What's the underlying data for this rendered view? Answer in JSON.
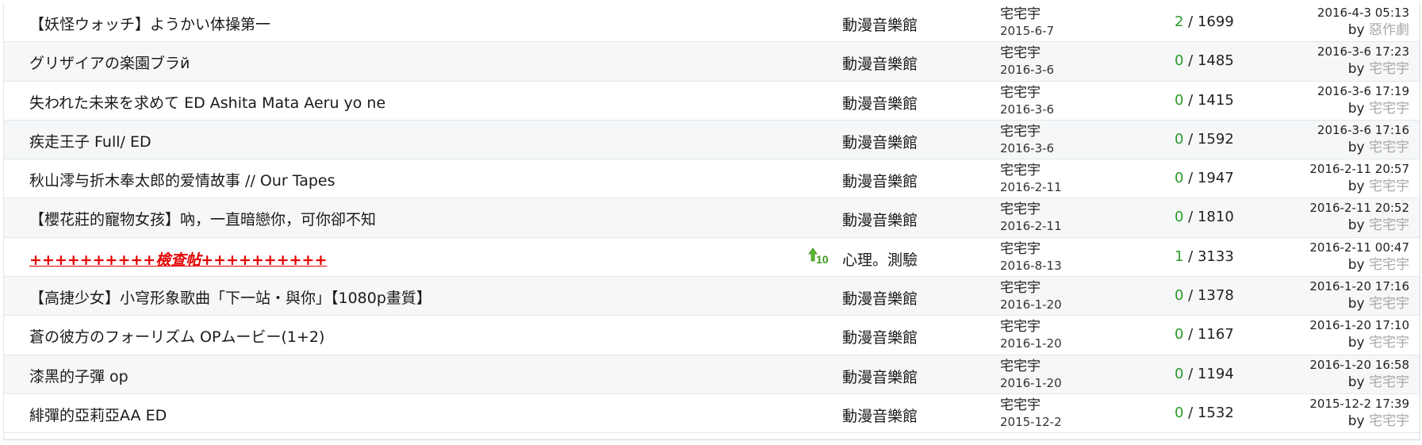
{
  "rows": [
    {
      "title": "【妖怪ウォッチ】ようかい体操第一",
      "forum": "動漫音樂館",
      "author": "宅宅宇",
      "post_date": "2015-6-7",
      "replies": "2",
      "sep": " / ",
      "views": "1699",
      "last_time": "2016-4-3 05:13",
      "by": "by ",
      "last_user": "惡作劇",
      "hot": false,
      "icon": false
    },
    {
      "title": "グリザイアの楽園ブラй",
      "forum": "動漫音樂館",
      "author": "宅宅宇",
      "post_date": "2016-3-6",
      "replies": "0",
      "sep": " / ",
      "views": "1485",
      "last_time": "2016-3-6 17:23",
      "by": "by ",
      "last_user": "宅宅宇",
      "hot": false,
      "icon": false
    },
    {
      "title": "失われた未来を求めて ED Ashita Mata Aeru yo ne",
      "forum": "動漫音樂館",
      "author": "宅宅宇",
      "post_date": "2016-3-6",
      "replies": "0",
      "sep": " / ",
      "views": "1415",
      "last_time": "2016-3-6 17:19",
      "by": "by ",
      "last_user": "宅宅宇",
      "hot": false,
      "icon": false
    },
    {
      "title": "疾走王子 Full/ ED",
      "forum": "動漫音樂館",
      "author": "宅宅宇",
      "post_date": "2016-3-6",
      "replies": "0",
      "sep": " / ",
      "views": "1592",
      "last_time": "2016-3-6 17:16",
      "by": "by ",
      "last_user": "宅宅宇",
      "hot": false,
      "icon": false
    },
    {
      "title": "秋山澪与折木奉太郎的爱情故事 // Our Tapes",
      "forum": "動漫音樂館",
      "author": "宅宅宇",
      "post_date": "2016-2-11",
      "replies": "0",
      "sep": " / ",
      "views": "1947",
      "last_time": "2016-2-11 20:57",
      "by": "by ",
      "last_user": "宅宅宇",
      "hot": false,
      "icon": false
    },
    {
      "title": "【櫻花莊的寵物女孩】吶，一直暗戀你，可你卻不知",
      "forum": "動漫音樂館",
      "author": "宅宅宇",
      "post_date": "2016-2-11",
      "replies": "0",
      "sep": " / ",
      "views": "1810",
      "last_time": "2016-2-11 20:52",
      "by": "by ",
      "last_user": "宅宅宇",
      "hot": false,
      "icon": false
    },
    {
      "title": "++++++++++檢查帖++++++++++",
      "forum": "心理。測驗",
      "author": "宅宅宇",
      "post_date": "2016-8-13",
      "replies": "1",
      "sep": " / ",
      "views": "3133",
      "last_time": "2016-2-11 00:47",
      "by": "by ",
      "last_user": "宅宅宇",
      "hot": true,
      "icon": true
    },
    {
      "title": "【高捷少女】小穹形象歌曲「下一站・與你」【1080p畫質】",
      "forum": "動漫音樂館",
      "author": "宅宅宇",
      "post_date": "2016-1-20",
      "replies": "0",
      "sep": " / ",
      "views": "1378",
      "last_time": "2016-1-20 17:16",
      "by": "by ",
      "last_user": "宅宅宇",
      "hot": false,
      "icon": false
    },
    {
      "title": "蒼の彼方のフォーリズム OPムービー(1+2)",
      "forum": "動漫音樂館",
      "author": "宅宅宇",
      "post_date": "2016-1-20",
      "replies": "0",
      "sep": " / ",
      "views": "1167",
      "last_time": "2016-1-20 17:10",
      "by": "by ",
      "last_user": "宅宅宇",
      "hot": false,
      "icon": false
    },
    {
      "title": "漆黑的子彈 op",
      "forum": "動漫音樂館",
      "author": "宅宅宇",
      "post_date": "2016-1-20",
      "replies": "0",
      "sep": " / ",
      "views": "1194",
      "last_time": "2016-1-20 16:58",
      "by": "by ",
      "last_user": "宅宅宇",
      "hot": false,
      "icon": false
    },
    {
      "title": "緋彈的亞莉亞AA ED",
      "forum": "動漫音樂館",
      "author": "宅宅宇",
      "post_date": "2015-12-2",
      "replies": "0",
      "sep": " / ",
      "views": "1532",
      "last_time": "2015-12-2 17:39",
      "by": "by ",
      "last_user": "宅宅宇",
      "hot": false,
      "icon": false
    }
  ],
  "icons": {
    "rating_icon": "thumb-up-10-icon"
  },
  "colors": {
    "reply_count": "#2a9a2a",
    "hot_title": "#e40000",
    "last_user": "#a8a8a8",
    "row_alt": "#f5f7f8"
  }
}
